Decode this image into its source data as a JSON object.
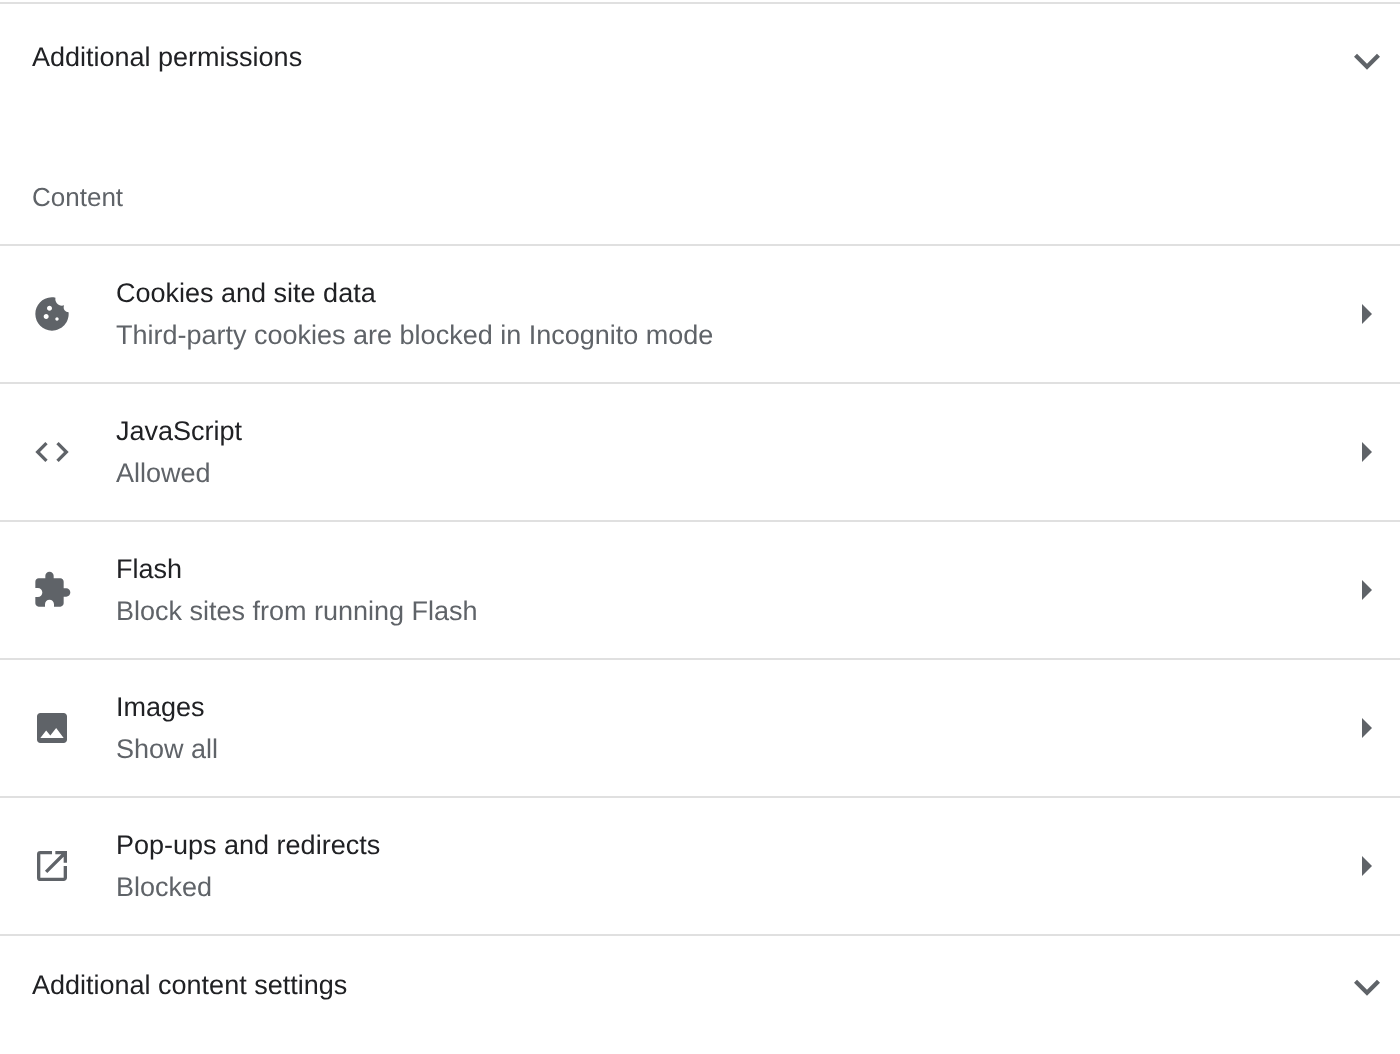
{
  "permissions_section": {
    "label": "Additional permissions",
    "expanded": false
  },
  "content_header": "Content",
  "items": [
    {
      "kind": "cookie",
      "title": "Cookies and site data",
      "subtitle": "Third-party cookies are blocked in Incognito mode"
    },
    {
      "kind": "code",
      "title": "JavaScript",
      "subtitle": "Allowed"
    },
    {
      "kind": "puzzle",
      "title": "Flash",
      "subtitle": "Block sites from running Flash"
    },
    {
      "kind": "image",
      "title": "Images",
      "subtitle": "Show all"
    },
    {
      "kind": "popup",
      "title": "Pop-ups and redirects",
      "subtitle": "Blocked"
    }
  ],
  "content_settings_section": {
    "label": "Additional content settings",
    "expanded": false
  }
}
